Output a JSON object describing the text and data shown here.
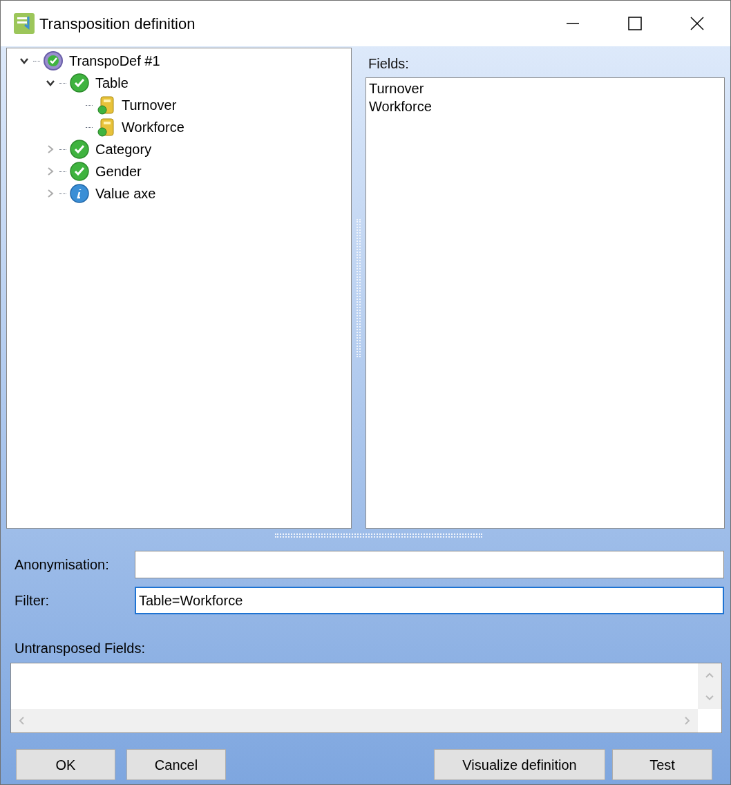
{
  "window": {
    "title": "Transposition definition"
  },
  "tree": [
    {
      "label": "TranspoDef #1",
      "kind": "root",
      "expanded": true,
      "children": [
        {
          "label": "Table",
          "kind": "ok",
          "expanded": true,
          "children": [
            {
              "label": "Turnover",
              "kind": "field"
            },
            {
              "label": "Workforce",
              "kind": "field"
            }
          ]
        },
        {
          "label": "Category",
          "kind": "ok",
          "expanded": false
        },
        {
          "label": "Gender",
          "kind": "ok",
          "expanded": false
        },
        {
          "label": "Value axe",
          "kind": "info",
          "expanded": false
        }
      ]
    }
  ],
  "fields_panel": {
    "label": "Fields:",
    "items": [
      "Turnover",
      "Workforce"
    ]
  },
  "form": [
    {
      "label": "Anonymisation:",
      "focused": false
    },
    {
      "label": "Filter:",
      "value": "Table=Workforce",
      "focused": true
    }
  ],
  "untransposed": {
    "label": "Untransposed Fields:"
  },
  "buttons_left": [
    "OK",
    "Cancel"
  ],
  "buttons_right": [
    "Visualize definition",
    "Test"
  ]
}
